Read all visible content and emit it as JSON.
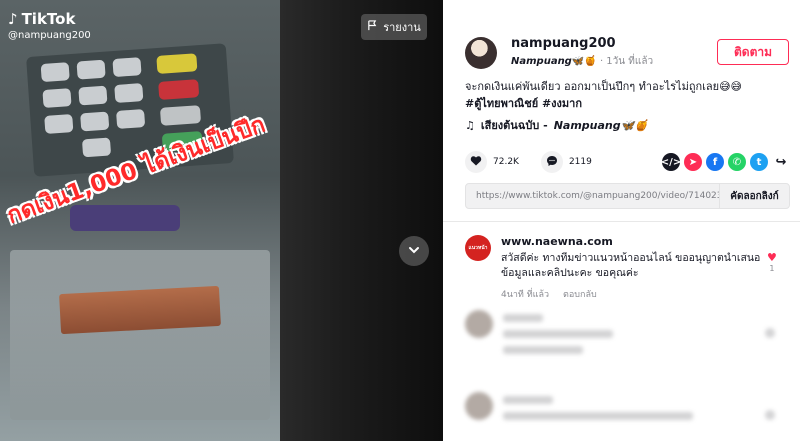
{
  "video": {
    "brand": "TikTok",
    "username_overlay": "@nampuang200",
    "overlay_caption": "กดเงิน1,000 ได้เงินเป็นปึก",
    "report_label": "รายงาน"
  },
  "author": {
    "username": "nampuang200",
    "nickname": "Nampuang",
    "nickname_emoji": "🦋🍯",
    "time_ago": "· 1วัน ที่แล้ว",
    "follow_label": "ติดตาม"
  },
  "post": {
    "description": "จะกดเงินแค่พันเดียว ออกมาเป็นปึกๆ ทำอะไรไม่ถูกเลย😅😅",
    "hashtags": "#ตู้ไทยพาณิชย์ #งงมาก",
    "music_prefix": "เสียงต้นฉบับ -",
    "music_artist": "Nampuang🦋🍯"
  },
  "stats": {
    "likes": "72.2K",
    "comments": "2119"
  },
  "share": {
    "link": "https://www.tiktok.com/@nampuang200/video/7140238...",
    "copy_label": "คัดลอกลิงก์"
  },
  "comments": [
    {
      "avatar_text": "แนวหน้า",
      "name": "www.naewna.com",
      "text": "สวัสดีค่ะ ทางทีมข่าวแนวหน้าออนไลน์ ขออนุญาตนำเสนอข้อมูลและคลิปนะคะ ขอคุณค่ะ",
      "time": "4นาที ที่แล้ว",
      "reply_label": "ตอบกลับ",
      "likes": "1"
    }
  ],
  "colors": {
    "accent": "#fe2c55",
    "whatsapp": "#25d366",
    "facebook": "#1877f2",
    "twitter": "#1da1f2",
    "line": "#06c755",
    "embed": "#161823"
  }
}
